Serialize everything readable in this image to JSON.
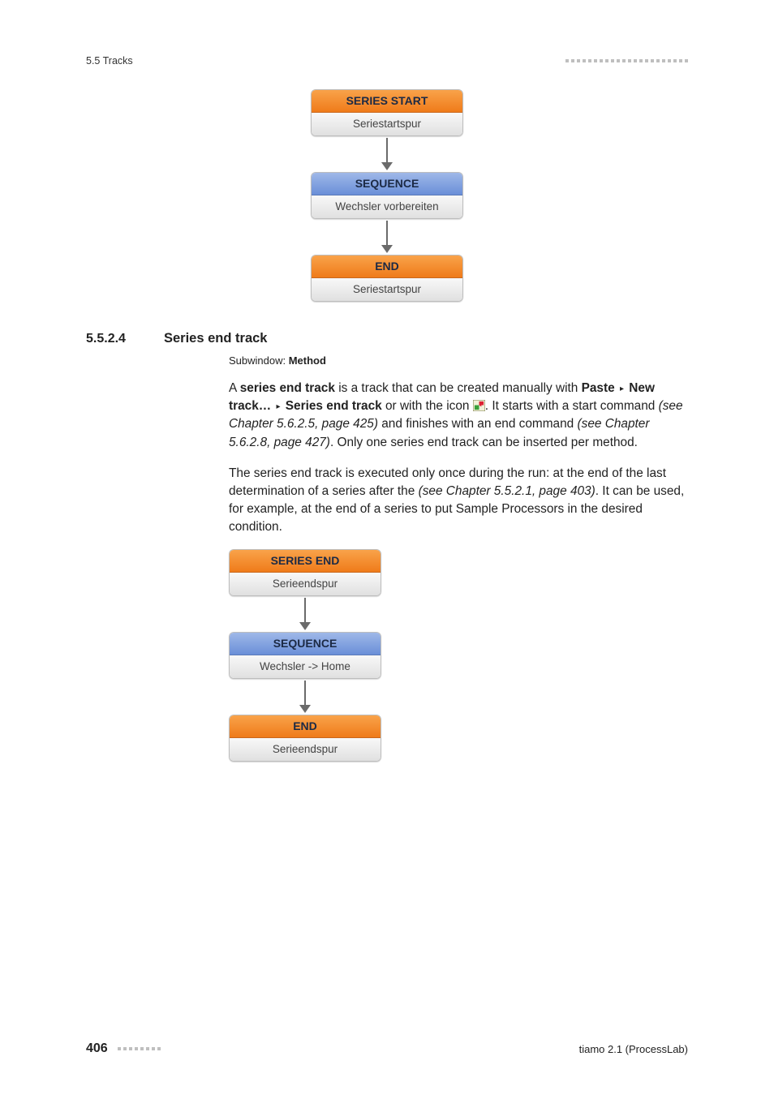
{
  "header": {
    "left": "5.5 Tracks"
  },
  "diagram1": {
    "blocks": [
      {
        "head": "SERIES START",
        "sub": "Seriestartspur",
        "color": "orange"
      },
      {
        "head": "SEQUENCE",
        "sub": "Wechsler vorbereiten",
        "color": "blue"
      },
      {
        "head": "END",
        "sub": "Seriestartspur",
        "color": "orange"
      }
    ]
  },
  "section": {
    "number": "5.5.2.4",
    "title": "Series end track"
  },
  "sub": {
    "label": "Subwindow: ",
    "value": "Method"
  },
  "para1_parts": {
    "a": "A ",
    "b": "series end track",
    "c": " is a track that can be created manually with ",
    "d": "Paste",
    "e": "New track…",
    "f": "Series end track",
    "g": " or with the icon ",
    "h": ". It starts with a start command ",
    "i": "(see Chapter 5.6.2.5, page 425)",
    "j": " and finishes with an end command ",
    "k": "(see Chapter 5.6.2.8, page 427)",
    "l": ". Only one series end track can be inserted per method."
  },
  "para2_parts": {
    "a": "The series end track is executed only once during the run: at the end of the last determination of a series after the ",
    "b": "(see Chapter 5.5.2.1, page 403)",
    "c": ". It can be used, for example, at the end of a series to put Sample Processors in the desired condition."
  },
  "diagram2": {
    "blocks": [
      {
        "head": "SERIES END",
        "sub": "Serieendspur",
        "color": "orange"
      },
      {
        "head": "SEQUENCE",
        "sub": "Wechsler -> Home",
        "color": "blue"
      },
      {
        "head": "END",
        "sub": "Serieendspur",
        "color": "orange"
      }
    ]
  },
  "footer": {
    "page": "406",
    "right": "tiamo 2.1 (ProcessLab)"
  },
  "glyph": {
    "triangle": "▸"
  }
}
